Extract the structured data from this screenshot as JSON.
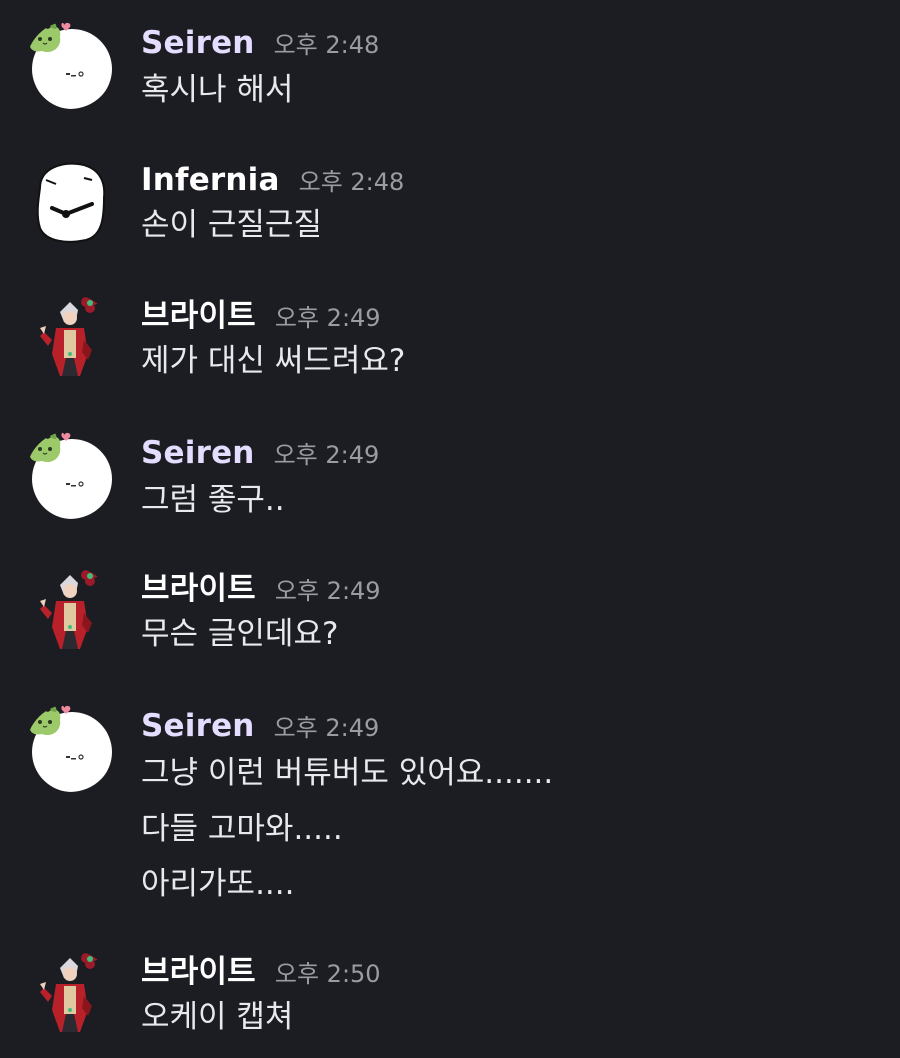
{
  "colors": {
    "background": "#1c1d22",
    "name_seiren": "#e4ddff",
    "name_infernia": "#ffffff",
    "name_bright": "#ffffff",
    "message_text": "#e8e9ec",
    "timestamp": "#9b9ca3"
  },
  "messages": [
    {
      "author": "Seiren",
      "avatar_icon": "white-blob-with-green-sprout-avatar-icon",
      "time": "오후 2:48",
      "lines": [
        "혹시나 해서"
      ]
    },
    {
      "author": "Infernia",
      "avatar_icon": "white-blob-clock-face-avatar-icon",
      "time": "오후 2:48",
      "lines": [
        "손이 근질근질"
      ]
    },
    {
      "author": "브라이트",
      "avatar_icon": "anime-character-red-jacket-avatar-icon",
      "time": "오후 2:49",
      "lines": [
        "제가 대신 써드려요?"
      ]
    },
    {
      "author": "Seiren",
      "avatar_icon": "white-blob-with-green-sprout-avatar-icon",
      "time": "오후 2:49",
      "lines": [
        "그럼 좋구.."
      ]
    },
    {
      "author": "브라이트",
      "avatar_icon": "anime-character-red-jacket-avatar-icon",
      "time": "오후 2:49",
      "lines": [
        "무슨 글인데요?"
      ]
    },
    {
      "author": "Seiren",
      "avatar_icon": "white-blob-with-green-sprout-avatar-icon",
      "time": "오후 2:49",
      "lines": [
        "그냥 이런 버튜버도 있어요.......",
        "다들 고마와.....",
        "아리가또...."
      ]
    },
    {
      "author": "브라이트",
      "avatar_icon": "anime-character-red-jacket-avatar-icon",
      "time": "오후 2:50",
      "lines": [
        "오케이 캡쳐"
      ]
    }
  ]
}
